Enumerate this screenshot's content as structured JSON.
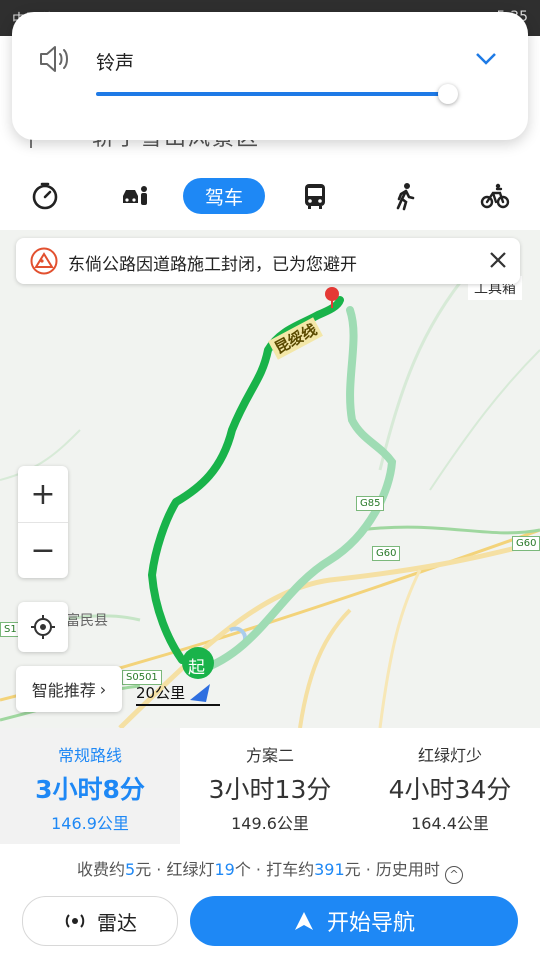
{
  "status_bar": {
    "left": "中国移动",
    "right": "5:35"
  },
  "volume": {
    "label": "铃声",
    "level_percent": 98,
    "accent": "#1e7ae6"
  },
  "destination_hint": "轿子雪山风景区",
  "tabs": [
    {
      "name": "taxi",
      "icon": "stopwatch-icon"
    },
    {
      "name": "carpool",
      "icon": "car-person-icon"
    },
    {
      "name": "drive",
      "label": "驾车"
    },
    {
      "name": "bus",
      "icon": "bus-icon"
    },
    {
      "name": "walk",
      "icon": "walk-icon"
    },
    {
      "name": "bike",
      "icon": "bike-icon"
    }
  ],
  "map": {
    "notice": "东倘公路因道路施工封闭，已为您避开",
    "toolbox": "工具箱",
    "route_label": "昆绥线",
    "place_label": "富民县",
    "start_label": "起",
    "scale": "20公里",
    "smart_recommend": "智能推荐",
    "shields": [
      "G85",
      "G60",
      "G60",
      "S0501",
      "S1"
    ]
  },
  "routes": [
    {
      "name": "常规路线",
      "time": "3小时8分",
      "distance": "146.9公里",
      "selected": true
    },
    {
      "name": "方案二",
      "time": "3小时13分",
      "distance": "149.6公里",
      "selected": false
    },
    {
      "name": "红绿灯少",
      "time": "4小时34分",
      "distance": "164.4公里",
      "selected": false
    }
  ],
  "info": {
    "toll_prefix": "收费约",
    "toll_value": "5",
    "toll_unit": "元 · 红绿灯",
    "lights_value": "19",
    "lights_unit": "个 · 打车约",
    "taxi_value": "391",
    "taxi_unit": "元 · 历史用时"
  },
  "buttons": {
    "radar": "雷达",
    "navigate": "开始导航"
  },
  "colors": {
    "accent": "#1e88f5",
    "route_main": "#19b34a",
    "route_alt": "#9fdcb4",
    "dest_pin": "#e53935"
  }
}
